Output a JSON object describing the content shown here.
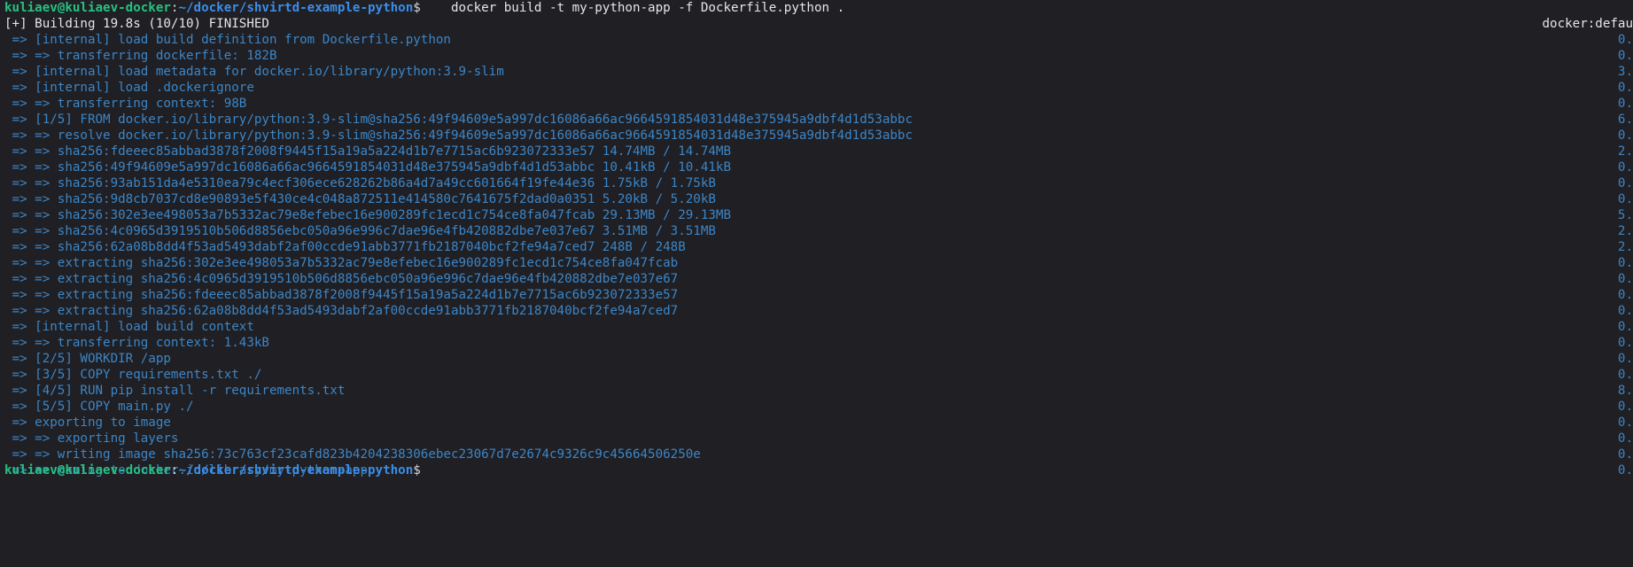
{
  "prompt": {
    "user_host": "kuliaev@kuliaev-docker",
    "sep": ":",
    "cwd": "~/docker/shvirtd-example-python",
    "symbol": "$",
    "command": "    docker build -t my-python-app -f Dockerfile.python ."
  },
  "header": {
    "text": "[+] Building 19.8s (10/10) FINISHED",
    "right": "docker:defau"
  },
  "lines": [
    {
      "text": " => [internal] load build definition from Dockerfile.python",
      "time": "0."
    },
    {
      "text": " => => transferring dockerfile: 182B",
      "time": "0."
    },
    {
      "text": " => [internal] load metadata for docker.io/library/python:3.9-slim",
      "time": "3."
    },
    {
      "text": " => [internal] load .dockerignore",
      "time": "0."
    },
    {
      "text": " => => transferring context: 98B",
      "time": "0."
    },
    {
      "text": " => [1/5] FROM docker.io/library/python:3.9-slim@sha256:49f94609e5a997dc16086a66ac9664591854031d48e375945a9dbf4d1d53abbc",
      "time": "6."
    },
    {
      "text": " => => resolve docker.io/library/python:3.9-slim@sha256:49f94609e5a997dc16086a66ac9664591854031d48e375945a9dbf4d1d53abbc",
      "time": "0."
    },
    {
      "text": " => => sha256:fdeeec85abbad3878f2008f9445f15a19a5a224d1b7e7715ac6b923072333e57 14.74MB / 14.74MB",
      "time": "2."
    },
    {
      "text": " => => sha256:49f94609e5a997dc16086a66ac9664591854031d48e375945a9dbf4d1d53abbc 10.41kB / 10.41kB",
      "time": "0."
    },
    {
      "text": " => => sha256:93ab151da4e5310ea79c4ecf306ece628262b86a4d7a49cc601664f19fe44e36 1.75kB / 1.75kB",
      "time": "0."
    },
    {
      "text": " => => sha256:9d8cb7037cd8e90893e5f430ce4c048a872511e414580c7641675f2dad0a0351 5.20kB / 5.20kB",
      "time": "0."
    },
    {
      "text": " => => sha256:302e3ee498053a7b5332ac79e8efebec16e900289fc1ecd1c754ce8fa047fcab 29.13MB / 29.13MB",
      "time": "5."
    },
    {
      "text": " => => sha256:4c0965d3919510b506d8856ebc050a96e996c7dae96e4fb420882dbe7e037e67 3.51MB / 3.51MB",
      "time": "2."
    },
    {
      "text": " => => sha256:62a08b8dd4f53ad5493dabf2af00ccde91abb3771fb2187040bcf2fe94a7ced7 248B / 248B",
      "time": "2."
    },
    {
      "text": " => => extracting sha256:302e3ee498053a7b5332ac79e8efebec16e900289fc1ecd1c754ce8fa047fcab",
      "time": "0."
    },
    {
      "text": " => => extracting sha256:4c0965d3919510b506d8856ebc050a96e996c7dae96e4fb420882dbe7e037e67",
      "time": "0."
    },
    {
      "text": " => => extracting sha256:fdeeec85abbad3878f2008f9445f15a19a5a224d1b7e7715ac6b923072333e57",
      "time": "0."
    },
    {
      "text": " => => extracting sha256:62a08b8dd4f53ad5493dabf2af00ccde91abb3771fb2187040bcf2fe94a7ced7",
      "time": "0."
    },
    {
      "text": " => [internal] load build context",
      "time": "0."
    },
    {
      "text": " => => transferring context: 1.43kB",
      "time": "0."
    },
    {
      "text": " => [2/5] WORKDIR /app",
      "time": "0."
    },
    {
      "text": " => [3/5] COPY requirements.txt ./",
      "time": "0."
    },
    {
      "text": " => [4/5] RUN pip install -r requirements.txt",
      "time": "8."
    },
    {
      "text": " => [5/5] COPY main.py ./",
      "time": "0."
    },
    {
      "text": " => exporting to image",
      "time": "0."
    },
    {
      "text": " => => exporting layers",
      "time": "0."
    },
    {
      "text": " => => writing image sha256:73c763cf23cafd823b4204238306ebec23067d7e2674c9326c9c45664506250e",
      "time": "0."
    },
    {
      "text": " => => naming to docker.io/library/my-python-app",
      "time": "0."
    }
  ],
  "colors": {
    "background": "#1f1f24",
    "prompt_user": "#26c281",
    "prompt_path": "#3b8eea",
    "build_step": "#3d86c6",
    "plain_text": "#d9d9d9"
  }
}
